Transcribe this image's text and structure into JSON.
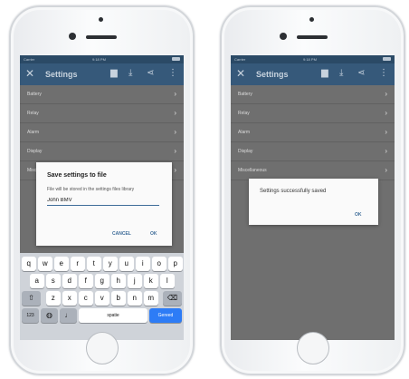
{
  "left_phone": {
    "status": {
      "carrier": "Carrier",
      "time": "9:18 PM"
    },
    "appbar": {
      "title": "Settings",
      "close_icon": "close-icon",
      "actions": [
        "save-icon",
        "download-icon",
        "share-icon",
        "more-vert-icon"
      ]
    },
    "rows": [
      {
        "label": "Battery"
      },
      {
        "label": "Relay"
      },
      {
        "label": "Alarm"
      },
      {
        "label": "Display"
      },
      {
        "label": "Miscellaneous"
      }
    ],
    "dialog": {
      "title": "Save settings to file",
      "message": "File will be stored in the settings files library",
      "input_value": "John BMV",
      "cancel_label": "CANCEL",
      "ok_label": "OK"
    },
    "keyboard": {
      "row1": [
        "q",
        "w",
        "e",
        "r",
        "t",
        "y",
        "u",
        "i",
        "o",
        "p"
      ],
      "row2": [
        "a",
        "s",
        "d",
        "f",
        "g",
        "h",
        "j",
        "k",
        "l"
      ],
      "row3": [
        "z",
        "x",
        "c",
        "v",
        "b",
        "n",
        "m"
      ],
      "shift_icon": "shift-icon",
      "backspace_icon": "backspace-icon",
      "numbers_label": "123",
      "globe_icon": "globe-icon",
      "mic_icon": "microphone-icon",
      "space_label": "spatie",
      "go_label": "Gereed"
    }
  },
  "right_phone": {
    "status": {
      "carrier": "Carrier",
      "time": "9:18 PM"
    },
    "appbar": {
      "title": "Settings"
    },
    "rows": [
      {
        "label": "Battery"
      },
      {
        "label": "Relay"
      },
      {
        "label": "Alarm"
      },
      {
        "label": "Display"
      },
      {
        "label": "Miscellaneous"
      }
    ],
    "dialog": {
      "message": "Settings successfully saved",
      "ok_label": "OK"
    }
  },
  "colors": {
    "appbar": "#36597a",
    "accent": "#3f6d99",
    "keyboard_go": "#2d7cf6"
  }
}
